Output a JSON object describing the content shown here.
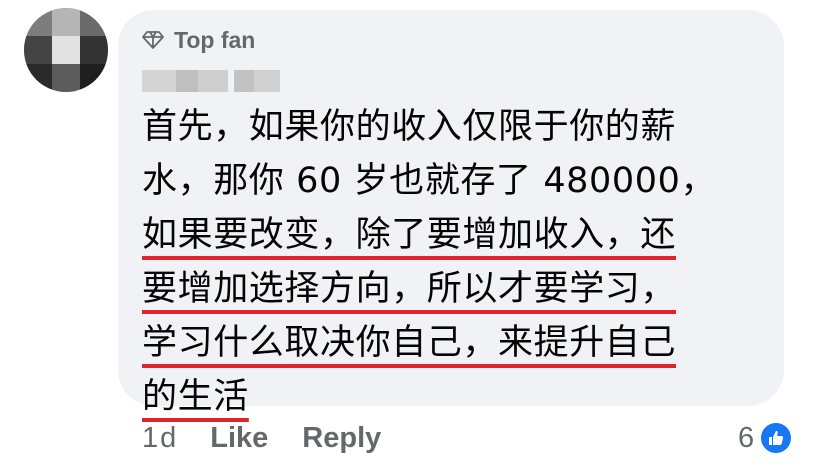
{
  "comment": {
    "badge_label": "Top fan",
    "lines": [
      {
        "text": "首先，如果你的收入仅限于你的薪",
        "underlined": false
      },
      {
        "text": "水，那你 60 岁也就存了 480000，",
        "underlined": false
      },
      {
        "text": "如果要改变，除了要增加收入，还",
        "underlined": true
      },
      {
        "text": "要增加选择方向，所以才要学习，",
        "underlined": true
      },
      {
        "text": "学习什么取决你自己，来提升自己",
        "underlined": true
      },
      {
        "text": "的生活",
        "underlined": true
      }
    ],
    "timestamp": "1d",
    "like_label": "Like",
    "reply_label": "Reply",
    "reaction_count": "6"
  },
  "colors": {
    "bubble": "#f0f2f5",
    "secondary_text": "#65676b",
    "underline": "#e0242d",
    "like_blue": "#1877f2"
  },
  "icons": {
    "badge": "diamond-icon",
    "reaction": "thumbs-up-icon"
  }
}
